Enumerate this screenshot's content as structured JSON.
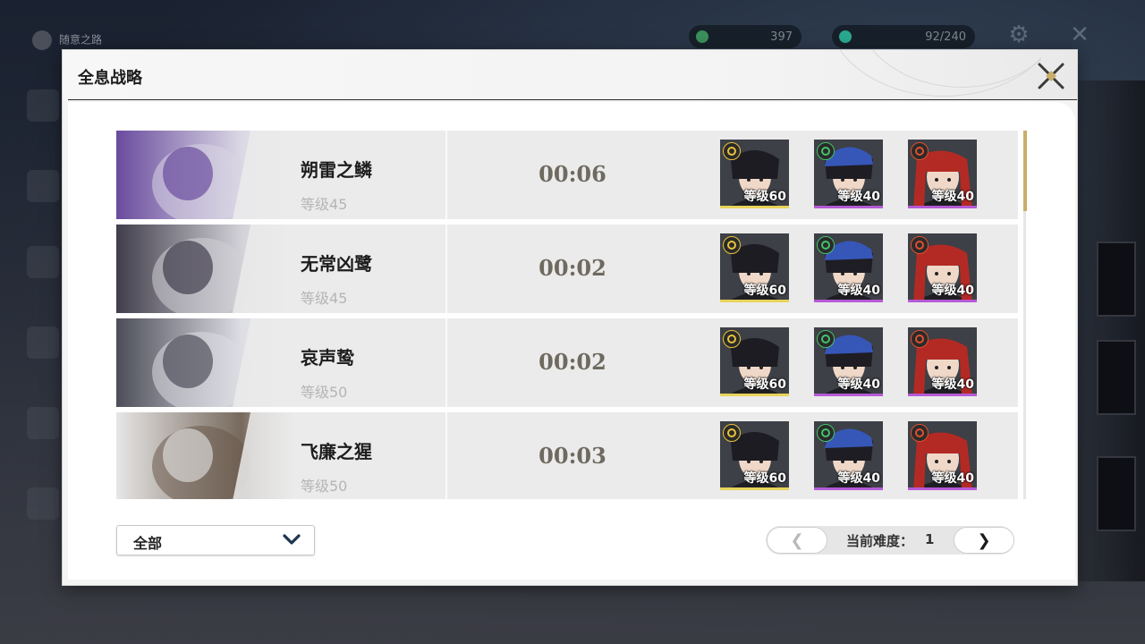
{
  "background": {
    "title": "随意之路",
    "resources": [
      {
        "value": "397",
        "color": "#3a8f5a"
      },
      {
        "value": "92/240",
        "color": "#2aa890"
      }
    ]
  },
  "panel": {
    "title": "全息战略"
  },
  "bosses": [
    {
      "name": "朔雷之鳞",
      "level": "等级45",
      "time": "00:06",
      "portrait_colors": [
        "#5b3a96",
        "#d9d6e4"
      ]
    },
    {
      "name": "无常凶鹭",
      "level": "等级45",
      "time": "00:02",
      "portrait_colors": [
        "#2e2a3a",
        "#cfcfd6"
      ]
    },
    {
      "name": "哀声鸷",
      "level": "等级50",
      "time": "00:02",
      "portrait_colors": [
        "#3a3c48",
        "#dcdce4"
      ]
    },
    {
      "name": "飞廉之猩",
      "level": "等级50",
      "time": "00:03",
      "portrait_colors": [
        "#e6e6e6",
        "#6a5a4c"
      ]
    }
  ],
  "team": [
    {
      "level": "等级60",
      "element_icon": "spectro-icon",
      "element_color": "#e8c23a",
      "bar_color": "#e8d35a",
      "hair": "#1c1c22",
      "hat": ""
    },
    {
      "level": "等级40",
      "element_icon": "aero-icon",
      "element_color": "#43c26b",
      "bar_color": "#b55ad6",
      "hair": "#1f1d24",
      "hat": "#3657b8"
    },
    {
      "level": "等级40",
      "element_icon": "fusion-icon",
      "element_color": "#e0502e",
      "bar_color": "#b55ad6",
      "hair": "#b32a24",
      "hat": ""
    }
  ],
  "filter": {
    "selected": "全部"
  },
  "pager": {
    "label": "当前难度：",
    "value": "1",
    "prev": "❮",
    "next": "❯"
  }
}
